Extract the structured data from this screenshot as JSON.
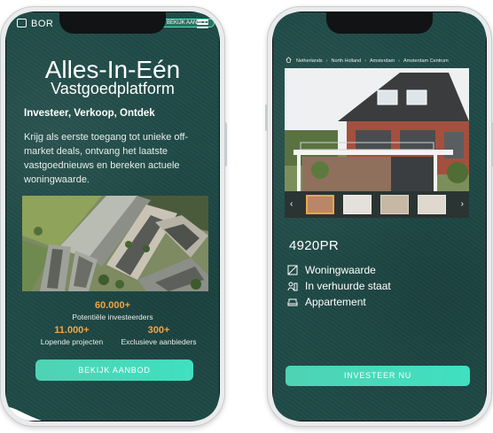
{
  "phone1": {
    "brand": "BOR",
    "top_button": "BEKIJK AANBOD",
    "hero_title": "Alles-In-Eén",
    "hero_subtitle": "Vastgoedplatform",
    "tagline": "Investeer, Verkoop, Ontdek",
    "description": "Krijg als eerste toegang tot unieke off-market deals, ontvang het laatste vastgoednieuws en bereken actuele woningwaarde.",
    "stats": {
      "investors_value": "60.000+",
      "investors_label": "Potentiële investeerders",
      "projects_value": "11.000+",
      "projects_label": "Lopende projecten",
      "offers_value": "300+",
      "offers_label": "Exclusieve aanbieders"
    },
    "cta": "BEKIJK AANBOD"
  },
  "phone2": {
    "breadcrumb": [
      "Netherlands",
      "North Holland",
      "Amsterdam",
      "Amsterdam Centrum"
    ],
    "postal_code": "4920PR",
    "features": [
      {
        "icon": "area-icon",
        "label": "Woningwaarde"
      },
      {
        "icon": "tenant-icon",
        "label": "In verhuurde staat"
      },
      {
        "icon": "sofa-icon",
        "label": "Appartement"
      }
    ],
    "cta": "INVESTEER NU"
  },
  "colors": {
    "background_teal": "#1f4a47",
    "accent_mint": "#3fe0c0",
    "stat_orange": "#f2a544"
  }
}
